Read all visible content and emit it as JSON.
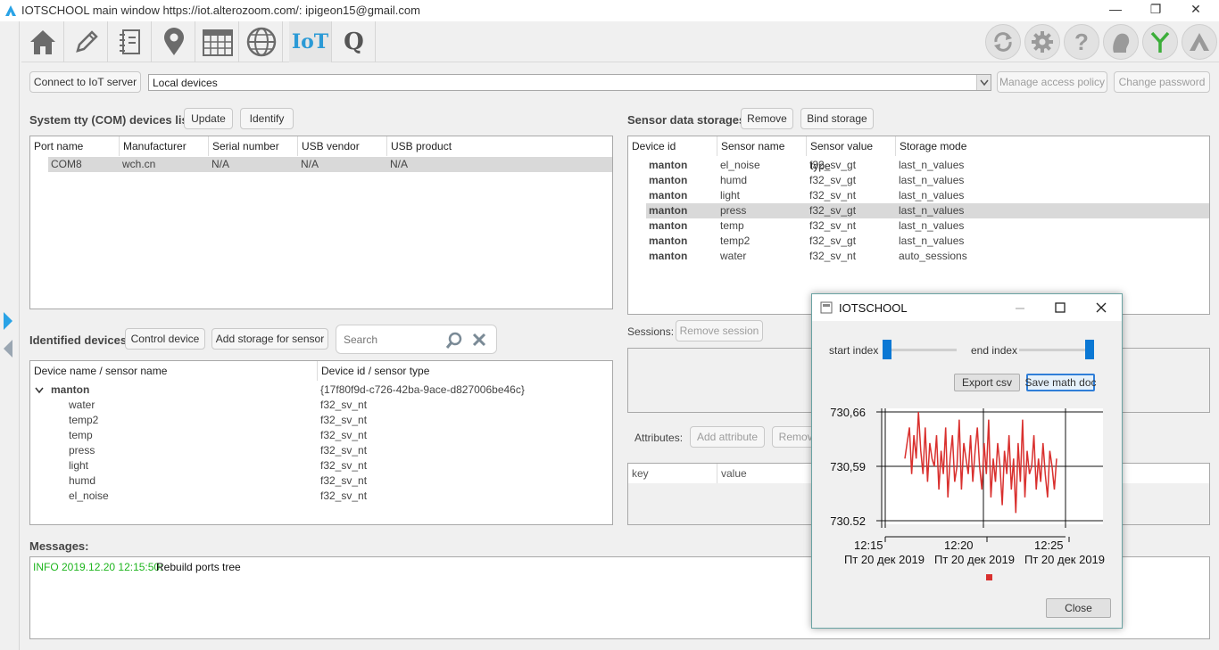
{
  "window": {
    "title": "IOTSCHOOL main window https://iot.alterozoom.com/: ipigeon15@gmail.com",
    "controls": {
      "minimize": "—",
      "restore": "❐",
      "close": "✕"
    }
  },
  "toolbar": {
    "left_tools": [
      "home-icon",
      "pencil-icon",
      "notebook-icon",
      "location-pin-icon",
      "calendar-icon",
      "globe-icon",
      "iot-tab",
      "q-tab"
    ],
    "iot_label": "IoT",
    "q_label": "Q",
    "right_tools": [
      "sync-icon",
      "settings-icon",
      "help-icon",
      "user-icon",
      "antenna-icon",
      "logo-icon"
    ]
  },
  "server_row": {
    "connect_label": "Connect to IoT server",
    "server_select_value": "Local devices",
    "manage_access_label": "Manage access policy",
    "change_password_label": "Change password"
  },
  "com_devices": {
    "title": "System tty (COM) devices list",
    "update_label": "Update",
    "identify_label": "Identify",
    "columns": [
      "Port name",
      "Manufacturer",
      "Serial number",
      "USB vendor",
      "USB product"
    ],
    "rows": [
      [
        "COM8",
        "wch.cn",
        "N/A",
        "N/A",
        "N/A"
      ]
    ]
  },
  "identified": {
    "title": "Identified devices",
    "control_label": "Control device",
    "add_storage_label": "Add storage for sensor",
    "search_placeholder": "Search",
    "columns": [
      "Device name / sensor name",
      "Device id / sensor type"
    ],
    "device": {
      "name": "manton",
      "id": "{17f80f9d-c726-42ba-9ace-d827006be46c}"
    },
    "sensors": [
      {
        "name": "water",
        "type": "f32_sv_nt"
      },
      {
        "name": "temp2",
        "type": "f32_sv_nt"
      },
      {
        "name": "temp",
        "type": "f32_sv_nt"
      },
      {
        "name": "press",
        "type": "f32_sv_nt"
      },
      {
        "name": "light",
        "type": "f32_sv_nt"
      },
      {
        "name": "humd",
        "type": "f32_sv_nt"
      },
      {
        "name": "el_noise",
        "type": "f32_sv_nt"
      }
    ]
  },
  "storages": {
    "title": "Sensor data storages",
    "remove_label": "Remove",
    "bind_label": "Bind storage",
    "columns": [
      "Device id",
      "Sensor name",
      "Sensor value type",
      "Storage mode"
    ],
    "rows": [
      [
        "manton",
        "el_noise",
        "f32_sv_gt",
        "last_n_values"
      ],
      [
        "manton",
        "humd",
        "f32_sv_gt",
        "last_n_values"
      ],
      [
        "manton",
        "light",
        "f32_sv_nt",
        "last_n_values"
      ],
      [
        "manton",
        "press",
        "f32_sv_gt",
        "last_n_values"
      ],
      [
        "manton",
        "temp",
        "f32_sv_nt",
        "last_n_values"
      ],
      [
        "manton",
        "temp2",
        "f32_sv_gt",
        "last_n_values"
      ],
      [
        "manton",
        "water",
        "f32_sv_nt",
        "auto_sessions"
      ]
    ]
  },
  "sessions": {
    "label": "Sessions:",
    "remove_label": "Remove session"
  },
  "attributes": {
    "label": "Attributes:",
    "add_label": "Add attribute",
    "remove_label": "Remove",
    "columns": [
      "key",
      "value"
    ]
  },
  "messages": {
    "title": "Messages:",
    "entries": [
      {
        "prefix": "INFO 2019.12.20 12:15:50:",
        "text": "Rebuild ports tree"
      }
    ]
  },
  "dialog": {
    "title": "IOTSCHOOL",
    "start_label": "start index",
    "end_label": "end index",
    "export_label": "Export csv",
    "save_label": "Save math doc",
    "close_label": "Close"
  },
  "chart_data": {
    "type": "line",
    "y_ticks": [
      "730,66",
      "730,59",
      "730.52"
    ],
    "ylim": [
      730.52,
      730.66
    ],
    "x_ticks": [
      {
        "time": "12:15",
        "date": "Пт 20 дек 2019"
      },
      {
        "time": "12:20",
        "date": "Пт 20 дек 2019"
      },
      {
        "time": "12:25",
        "date": "Пт 20 дек 2019"
      }
    ],
    "grid": true,
    "series_color": "#d9302e",
    "legend_color": "#d9302e",
    "series": [
      {
        "values": [
          730.6,
          730.62,
          730.64,
          730.58,
          730.63,
          730.6,
          730.66,
          730.61,
          730.58,
          730.64,
          730.57,
          730.62,
          730.6,
          730.59,
          730.63,
          730.56,
          730.61,
          730.58,
          730.64,
          730.55,
          730.6,
          730.63,
          730.57,
          730.59,
          730.65,
          730.56,
          730.62,
          730.6,
          730.58,
          730.63,
          730.57,
          730.61,
          730.64,
          730.59,
          730.56,
          730.62,
          730.58,
          730.65,
          730.55,
          730.6,
          730.57,
          730.62,
          730.59,
          730.54,
          730.61,
          730.58,
          730.63,
          730.56,
          730.6,
          730.53,
          730.62,
          730.57,
          730.65,
          730.55,
          730.61,
          730.58,
          730.59,
          730.63,
          730.56,
          730.6,
          730.57,
          730.62,
          730.58,
          730.55,
          730.61,
          730.59,
          730.56,
          730.6
        ]
      }
    ]
  }
}
